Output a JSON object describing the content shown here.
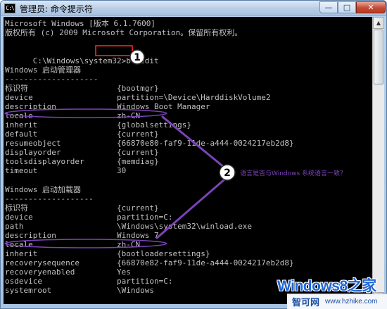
{
  "window": {
    "title": "管理员: 命令提示符",
    "icon_label": "C:\\",
    "buttons": {
      "minimize": "—",
      "maximize": "□",
      "close": "✕"
    }
  },
  "console": {
    "lines": [
      "Microsoft Windows [版本 6.1.7600]",
      "版权所有 (c) 2009 Microsoft Corporation。保留所有权利。",
      "",
      "C:\\Windows\\system32>",
      "",
      "Windows 启动管理器",
      "--------------------"
    ],
    "command": "bcdedit",
    "boot_manager": {
      "heading": "Windows 启动管理器",
      "separator": "--------------------",
      "entries": [
        {
          "key": "标识符",
          "value": "{bootmgr}"
        },
        {
          "key": "device",
          "value": "partition=\\Device\\HarddiskVolume2"
        },
        {
          "key": "description",
          "value": "Windows Boot Manager"
        },
        {
          "key": "locale",
          "value": "zh-CN"
        },
        {
          "key": "inherit",
          "value": "{globalsettings}"
        },
        {
          "key": "default",
          "value": "{current}"
        },
        {
          "key": "resumeobject",
          "value": "{66870e80-faf9-11de-a444-0024217eb2d8}"
        },
        {
          "key": "displayorder",
          "value": "{current}"
        },
        {
          "key": "toolsdisplayorder",
          "value": "{memdiag}"
        },
        {
          "key": "timeout",
          "value": "30"
        }
      ]
    },
    "boot_loader": {
      "heading": "Windows 启动加载器",
      "separator": "-------------------",
      "entries": [
        {
          "key": "标识符",
          "value": "{current}"
        },
        {
          "key": "device",
          "value": "partition=C:"
        },
        {
          "key": "path",
          "value": "\\Windows\\system32\\winload.exe"
        },
        {
          "key": "description",
          "value": "Windows 7"
        },
        {
          "key": "locale",
          "value": "zh-CN"
        },
        {
          "key": "inherit",
          "value": "{bootloadersettings}"
        },
        {
          "key": "recoverysequence",
          "value": "{66870e82-faf9-11de-a444-0024217eb2d8}"
        },
        {
          "key": "recoveryenabled",
          "value": "Yes"
        },
        {
          "key": "osdevice",
          "value": "partition=C:"
        },
        {
          "key": "systemroot",
          "value": "\\Windows"
        }
      ]
    }
  },
  "annotations": {
    "marker_1": "1",
    "marker_2": "2",
    "callout": "语言是否与Windows 系统语言一致？",
    "color": "#7b43b8",
    "highlight_color": "#ff2a2a"
  },
  "watermark": {
    "main": "Windows8之家",
    "name": "智可网",
    "url": "www.hzhike.com"
  }
}
